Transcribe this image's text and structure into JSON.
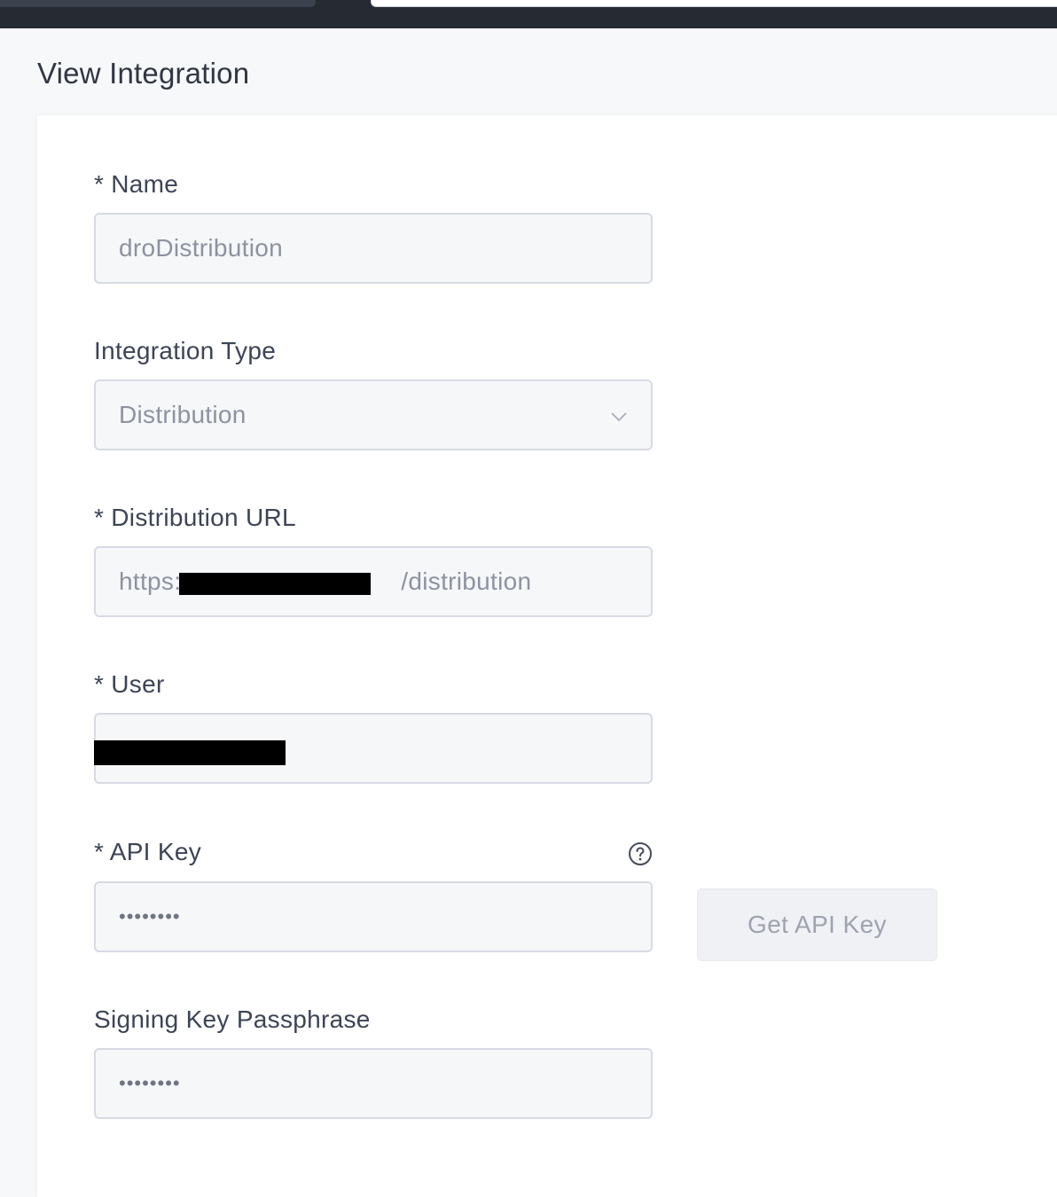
{
  "page_title": "View Integration",
  "form": {
    "name": {
      "label": "* Name",
      "value": "droDistribution"
    },
    "integration_type": {
      "label": "Integration Type",
      "value": "Distribution"
    },
    "distribution_url": {
      "label": "* Distribution URL",
      "value_prefix": "https:",
      "value_suffix": "/distribution"
    },
    "user": {
      "label": "* User",
      "value": ""
    },
    "api_key": {
      "label": "* API Key",
      "value": "••••••••",
      "help_icon": "question-circle-icon"
    },
    "get_api_key_button": "Get API Key",
    "signing_key_passphrase": {
      "label": "Signing Key Passphrase",
      "value": "••••••••"
    }
  },
  "colors": {
    "topbar": "#262a33",
    "input_bg": "#f6f7f9",
    "input_border": "#d7dae3",
    "button_bg": "#eff1f5",
    "redaction": "#000000"
  }
}
